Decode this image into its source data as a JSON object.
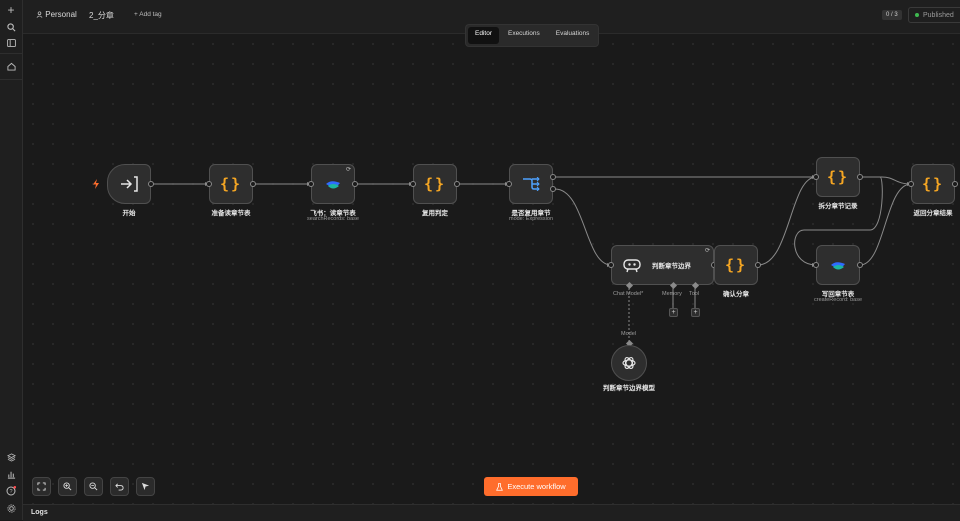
{
  "header": {
    "owner": "Personal",
    "workflow_name": "2_分章",
    "add_tag": "+ Add tag",
    "counter": "0 / 3",
    "published": "Published"
  },
  "tabs": [
    {
      "label": "Editor",
      "active": true
    },
    {
      "label": "Executions",
      "active": false
    },
    {
      "label": "Evaluations",
      "active": false
    }
  ],
  "nodes": {
    "start": {
      "title": "开始"
    },
    "prepare": {
      "title": "准备读章节表"
    },
    "feishu_read": {
      "title": "飞书：读章节表",
      "subtitle": "searchRecords: base"
    },
    "reuse_check": {
      "title": "复用判定"
    },
    "is_reuse": {
      "title": "是否复用章节",
      "subtitle": "mode: Expression"
    },
    "judge": {
      "title": "判断章节边界",
      "chat_model": "Chat Model*",
      "memory": "Memory",
      "tool": "Tool"
    },
    "confirm": {
      "title": "确认分章"
    },
    "split_records": {
      "title": "拆分章节记录"
    },
    "write_back": {
      "title": "写回章节表",
      "subtitle": "createRecord: base"
    },
    "return_result": {
      "title": "返回分章结果"
    },
    "model": {
      "title": "判断章节边界模型",
      "connector": "Model"
    }
  },
  "execute_button": "Execute workflow",
  "logs_label": "Logs",
  "colors": {
    "accent": "#ff6d2c",
    "braces": "#f5a623",
    "published_dot": "#3fb950"
  }
}
